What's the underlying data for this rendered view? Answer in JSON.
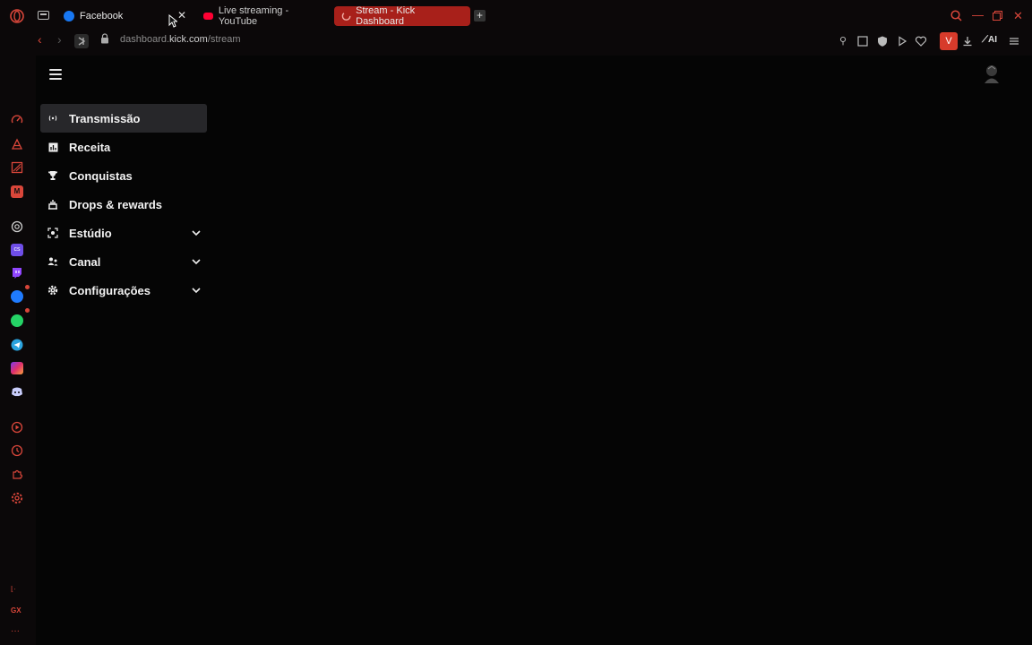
{
  "tabs": [
    {
      "label": "Facebook",
      "icon": "facebook-icon",
      "color": "#1877f2"
    },
    {
      "label": "Live streaming - YouTube",
      "icon": "youtube-icon",
      "color": "#ff0033"
    },
    {
      "label": "Stream - Kick Dashboard",
      "icon": "loading-spinner-icon",
      "active": true,
      "color": "#a8201a"
    }
  ],
  "address": {
    "domain_prefix": "dashboard.",
    "domain_main": "kick.com",
    "path": "/stream"
  },
  "toolbar": {
    "vpn_label": "V",
    "ai_label": "AI"
  },
  "opera_sidebar": {
    "bottom_label": "GX"
  },
  "nav": {
    "items": [
      {
        "label": "Transmissão",
        "icon": "broadcast-icon",
        "active": true
      },
      {
        "label": "Receita",
        "icon": "chart-icon"
      },
      {
        "label": "Conquistas",
        "icon": "trophy-icon"
      },
      {
        "label": "Drops & rewards",
        "icon": "gift-icon"
      },
      {
        "label": "Estúdio",
        "icon": "studio-icon",
        "expandable": true
      },
      {
        "label": "Canal",
        "icon": "users-icon",
        "expandable": true
      },
      {
        "label": "Configurações",
        "icon": "gear-icon",
        "expandable": true
      }
    ]
  },
  "colors": {
    "accent": "#d9463a",
    "active_tab": "#a8201a",
    "background": "#050505",
    "active_item": "#27272a"
  }
}
